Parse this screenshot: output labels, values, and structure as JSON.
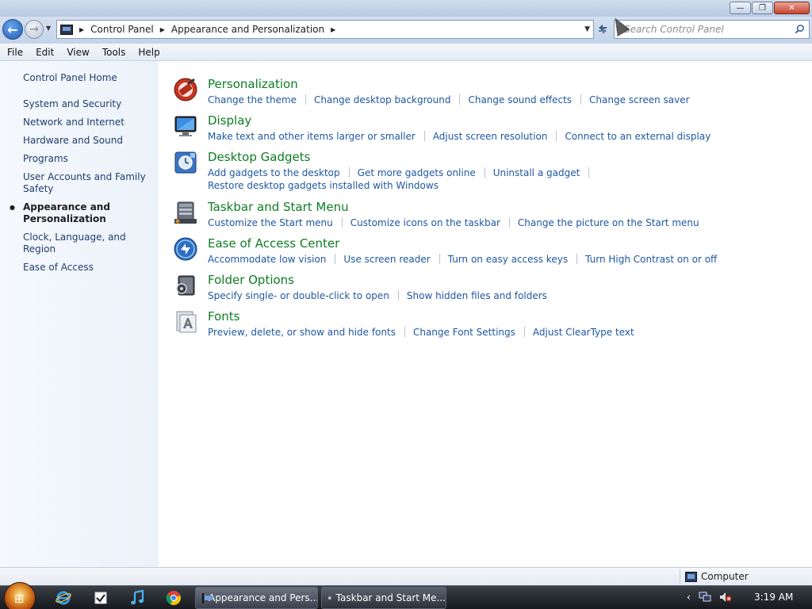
{
  "window": {
    "minimize_label": "—",
    "maximize_label": "❐",
    "close_label": "✕"
  },
  "address": {
    "breadcrumbs": [
      "Control Panel",
      "Appearance and Personalization"
    ],
    "search_placeholder": "Search Control Panel"
  },
  "menu": [
    "File",
    "Edit",
    "View",
    "Tools",
    "Help"
  ],
  "sidebar": {
    "home": "Control Panel Home",
    "items": [
      {
        "label": "System and Security"
      },
      {
        "label": "Network and Internet"
      },
      {
        "label": "Hardware and Sound"
      },
      {
        "label": "Programs"
      },
      {
        "label": "User Accounts and Family Safety"
      },
      {
        "label": "Appearance and Personalization",
        "active": true
      },
      {
        "label": "Clock, Language, and Region"
      },
      {
        "label": "Ease of Access"
      }
    ]
  },
  "categories": [
    {
      "title": "Personalization",
      "icon": "personalization-icon",
      "links": [
        "Change the theme",
        "Change desktop background",
        "Change sound effects",
        "Change screen saver"
      ]
    },
    {
      "title": "Display",
      "icon": "display-icon",
      "links": [
        "Make text and other items larger or smaller",
        "Adjust screen resolution",
        "Connect to an external display"
      ]
    },
    {
      "title": "Desktop Gadgets",
      "icon": "gadgets-icon",
      "links": [
        "Add gadgets to the desktop",
        "Get more gadgets online",
        "Uninstall a gadget",
        "Restore desktop gadgets installed with Windows"
      ]
    },
    {
      "title": "Taskbar and Start Menu",
      "icon": "taskbar-icon",
      "links": [
        "Customize the Start menu",
        "Customize icons on the taskbar",
        "Change the picture on the Start menu"
      ]
    },
    {
      "title": "Ease of Access Center",
      "icon": "ease-of-access-icon",
      "links": [
        "Accommodate low vision",
        "Use screen reader",
        "Turn on easy access keys",
        "Turn High Contrast on or off"
      ]
    },
    {
      "title": "Folder Options",
      "icon": "folder-options-icon",
      "links": [
        "Specify single- or double-click to open",
        "Show hidden files and folders"
      ]
    },
    {
      "title": "Fonts",
      "icon": "fonts-icon",
      "links": [
        "Preview, delete, or show and hide fonts",
        "Change Font Settings",
        "Adjust ClearType text"
      ]
    }
  ],
  "statusbar": {
    "location": "Computer"
  },
  "taskbar": {
    "tasks": [
      {
        "label": "Appearance and Pers...",
        "active": true
      },
      {
        "label": "Taskbar and Start Me...",
        "active": false
      }
    ],
    "clock": "3:19 AM"
  },
  "colors": {
    "category_title": "#0e7d23",
    "link": "#1f57a1",
    "sidebar_link": "#1e3c6e"
  }
}
